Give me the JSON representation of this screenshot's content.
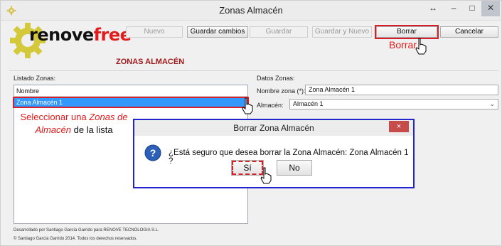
{
  "window": {
    "title": "Zonas Almacén",
    "controls": {
      "resize": "↔",
      "minimize": "–",
      "maximize": "□",
      "close": "✕"
    }
  },
  "brand": {
    "logo_part1": "renove",
    "logo_part2": "free",
    "section_title": "ZONAS ALMACÉN"
  },
  "toolbar": {
    "nuevo": "Nuevo",
    "guardar_cambios": "Guardar cambios",
    "guardar": "Guardar",
    "guardar_y_nuevo": "Guardar y Nuevo",
    "borrar": "Borrar",
    "cancelar": "Cancelar"
  },
  "annotations": {
    "borrar": "Borrar",
    "select_part1": "Seleccionar una ",
    "select_italic": "Zonas de Almacén",
    "select_part2": " de la lista"
  },
  "list": {
    "label": "Listado Zonas:",
    "column_header": "Nombre",
    "rows": [
      "Zona Almacén 1"
    ]
  },
  "form": {
    "label": "Datos Zonas:",
    "nombre_label": "Nombre zona (*):",
    "nombre_value": "Zona Almacén 1",
    "almacen_label": "Almacén:",
    "almacen_value": "Almacén 1"
  },
  "footer": {
    "line1": "Desarrollado por Santiago García Garrido para RENOVE TECNOLOGIA S.L.",
    "line2": "© Santiago García Garrido 2014. Todos los derechos reservados."
  },
  "dialog": {
    "title": "Borrar Zona Almacén",
    "close": "×",
    "message": "¿Está seguro que desea borrar la Zona Almacén: Zona Almacén 1 ?",
    "yes": "Sí",
    "no": "No",
    "icon": "question-icon"
  },
  "colors": {
    "annotation": "#e31b1b",
    "selection": "#3399ff",
    "dialog_border": "#2323d0",
    "logo_accent": "#e31b1b"
  }
}
